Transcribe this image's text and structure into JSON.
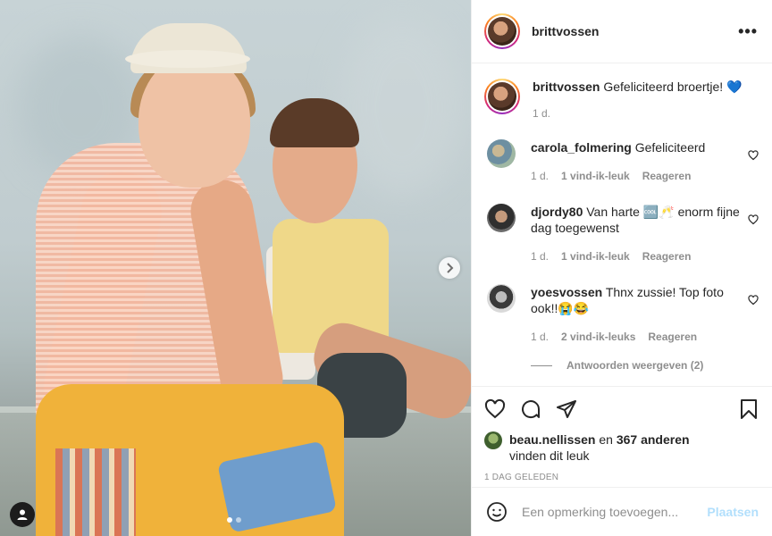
{
  "post": {
    "username": "brittvossen",
    "caption_text": "Gefeliciteerd broertje! 💙",
    "caption_time": "1 d."
  },
  "comments": [
    {
      "username": "carola_folmering",
      "text": "Gefeliciteerd",
      "time": "1 d.",
      "likes": "1 vind-ik-leuk",
      "reply": "Reageren",
      "avatar_color": "#9fb7a3"
    },
    {
      "username": "djordy80",
      "text": "Van harte 🆒🥂 enorm fijne dag toegewenst",
      "time": "1 d.",
      "likes": "1 vind-ik-leuk",
      "reply": "Reageren",
      "avatar_color": "#4a4a4a"
    },
    {
      "username": "yoesvossen",
      "text": "Thnx zussie! Top foto ook!!😭😂",
      "time": "1 d.",
      "likes": "2 vind-ik-leuks",
      "reply": "Reageren",
      "avatar_color": "#7a7a7a"
    }
  ],
  "view_replies": "Antwoorden weergeven (2)",
  "likes": {
    "user": "beau.nellissen",
    "connector": "en",
    "others": "367 anderen",
    "suffix": "vinden dit leuk"
  },
  "date": "1 DAG GELEDEN",
  "add_comment": {
    "placeholder": "Een opmerking toevoegen...",
    "post_label": "Plaatsen"
  },
  "colors": {
    "accent_disabled": "#b2dffc",
    "text": "#262626",
    "muted": "#8e8e8e"
  }
}
